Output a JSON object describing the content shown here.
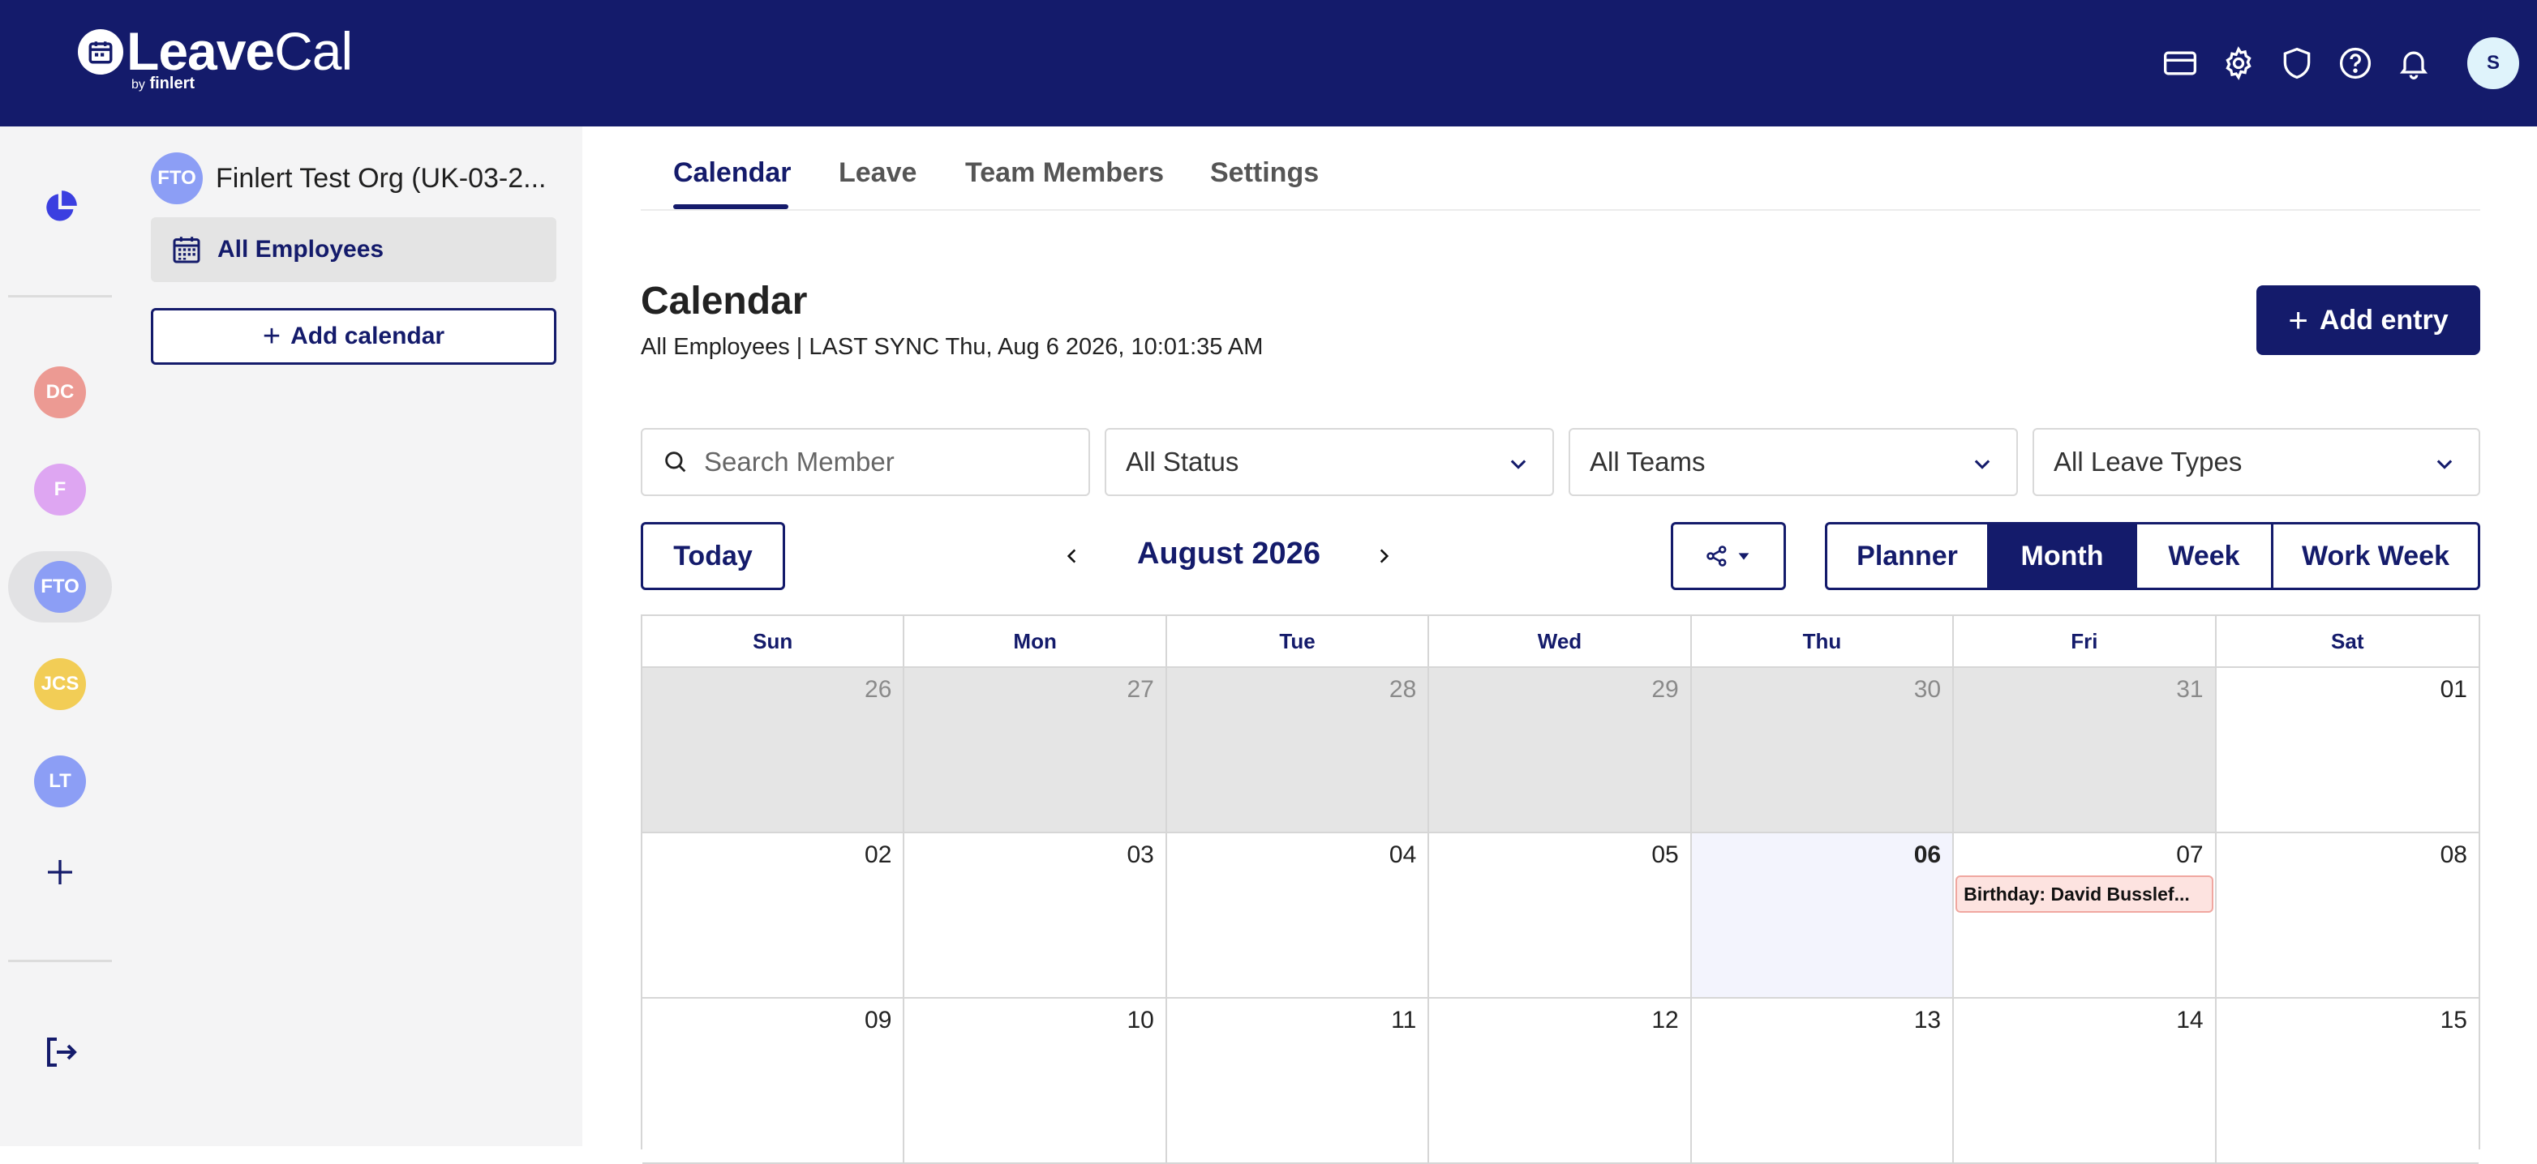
{
  "brand": {
    "name_bold": "Leave",
    "name_light": "Cal",
    "sub_by": "by",
    "sub_name": "finlert"
  },
  "topbar": {
    "user_initial": "S"
  },
  "rail": {
    "items": [
      {
        "initials": "DC",
        "color": "#ec9a93"
      },
      {
        "initials": "F",
        "color": "#dea6f2"
      },
      {
        "initials": "FTO",
        "color": "#8c9ef5",
        "active": true
      },
      {
        "initials": "JCS",
        "color": "#f2cd56"
      },
      {
        "initials": "LT",
        "color": "#8c9ef5"
      }
    ]
  },
  "panel": {
    "org_initials": "FTO",
    "org_name": "Finlert Test Org (UK-03-2...",
    "calendar_name": "All Employees",
    "add_calendar_label": "Add calendar"
  },
  "tabs": [
    "Calendar",
    "Leave",
    "Team Members",
    "Settings"
  ],
  "header": {
    "title": "Calendar",
    "subtitle": "All Employees | LAST SYNC Thu, Aug 6 2026, 10:01:35 AM",
    "add_entry_label": "Add entry"
  },
  "filters": {
    "search_placeholder": "Search Member",
    "status": "All Status",
    "teams": "All Teams",
    "leave_types": "All Leave Types"
  },
  "toolbar": {
    "today_label": "Today",
    "month_label": "August 2026",
    "views": [
      "Planner",
      "Month",
      "Week",
      "Work Week"
    ],
    "active_view": "Month"
  },
  "calendar": {
    "weekdays": [
      "Sun",
      "Mon",
      "Tue",
      "Wed",
      "Thu",
      "Fri",
      "Sat"
    ],
    "weeks": [
      [
        {
          "d": "26",
          "other": true
        },
        {
          "d": "27",
          "other": true
        },
        {
          "d": "28",
          "other": true
        },
        {
          "d": "29",
          "other": true
        },
        {
          "d": "30",
          "other": true
        },
        {
          "d": "31",
          "other": true
        },
        {
          "d": "01"
        }
      ],
      [
        {
          "d": "02"
        },
        {
          "d": "03"
        },
        {
          "d": "04"
        },
        {
          "d": "05"
        },
        {
          "d": "06",
          "today": true
        },
        {
          "d": "07",
          "event": "Birthday: David Busslef..."
        },
        {
          "d": "08"
        }
      ],
      [
        {
          "d": "09"
        },
        {
          "d": "10"
        },
        {
          "d": "11"
        },
        {
          "d": "12"
        },
        {
          "d": "13"
        },
        {
          "d": "14"
        },
        {
          "d": "15"
        }
      ]
    ]
  }
}
